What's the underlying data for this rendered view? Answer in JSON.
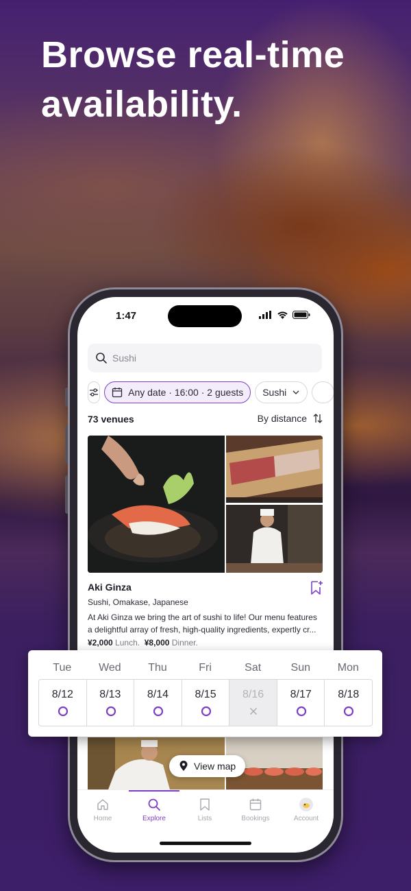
{
  "headline": {
    "line1": "Browse real-time",
    "line2": "availability."
  },
  "status_bar": {
    "time": "1:47"
  },
  "search": {
    "value": "Sushi"
  },
  "filters": {
    "date_filter": "Any date · 16:00 · 2 guests",
    "cuisine_filter": "Sushi"
  },
  "results": {
    "count": "73 venues",
    "sort_label": "By distance"
  },
  "venue": {
    "name": "Aki Ginza",
    "tags": "Sushi, Omakase, Japanese",
    "description_line1": "At Aki Ginza we bring the art of sushi to life! Our menu features",
    "description_line2": "a delightful array of fresh, high-quality ingredients, expertly cr...",
    "lunch_price": "¥2,000",
    "lunch_label": "Lunch.",
    "dinner_price": "¥8,000",
    "dinner_label": "Dinner."
  },
  "view_map": {
    "label": "View map"
  },
  "tabbar": {
    "home": "Home",
    "explore": "Explore",
    "lists": "Lists",
    "bookings": "Bookings",
    "account": "Account",
    "active": "Explore"
  },
  "calendar": {
    "days": [
      "Tue",
      "Wed",
      "Thu",
      "Fri",
      "Sat",
      "Sun",
      "Mon"
    ],
    "dates": [
      {
        "date": "8/12",
        "available": true
      },
      {
        "date": "8/13",
        "available": true
      },
      {
        "date": "8/14",
        "available": true
      },
      {
        "date": "8/15",
        "available": true
      },
      {
        "date": "8/16",
        "available": false
      },
      {
        "date": "8/17",
        "available": true
      },
      {
        "date": "8/18",
        "available": true
      }
    ]
  },
  "colors": {
    "accent": "#7a3fc4",
    "background": "#3f1f6b"
  },
  "icons": {
    "search": "search-icon",
    "settings": "sliders-icon",
    "calendar": "calendar-icon",
    "sort": "sort-arrows-icon",
    "bookmark": "bookmark-plus-icon",
    "map_pin": "map-pin-icon"
  }
}
